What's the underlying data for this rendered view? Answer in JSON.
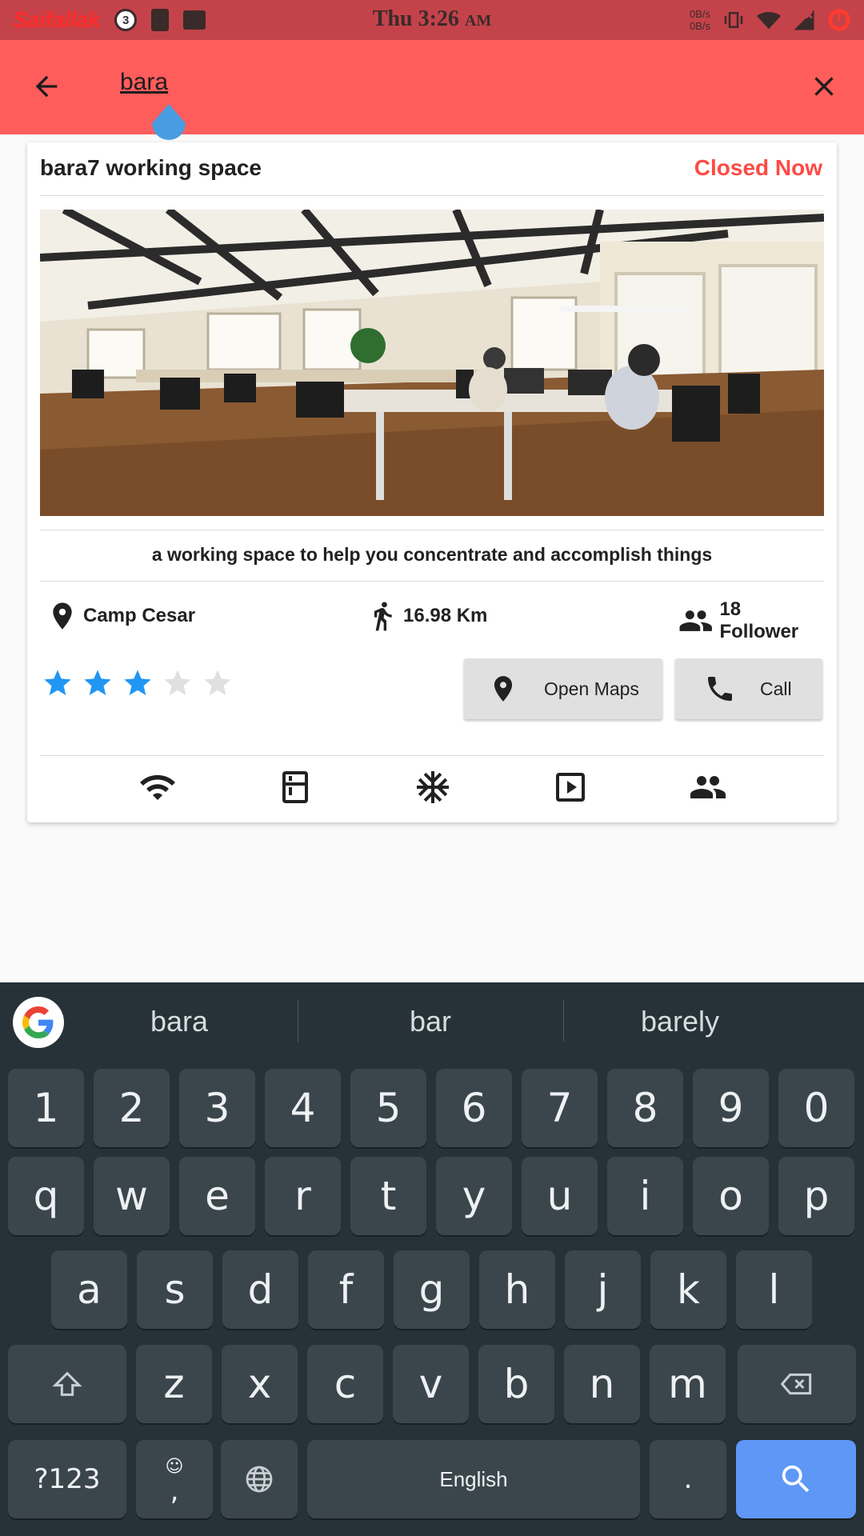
{
  "status_bar": {
    "brand": "Saifallak",
    "notif_count": "3",
    "time": "Thu 3:26",
    "time_suffix": "AM",
    "speed_up": "0B/s",
    "speed_down": "0B/s"
  },
  "app_bar": {
    "search_value": "bara"
  },
  "card": {
    "title": "bara7 working space",
    "status": "Closed Now",
    "description": "a working space to help you concentrate and accomplish things",
    "location": "Camp Cesar",
    "distance": "16.98 Km",
    "followers": "18 Follower",
    "rating": 3,
    "rating_max": 5,
    "open_maps_label": "Open Maps",
    "call_label": "Call",
    "amenities": [
      "wifi-icon",
      "fridge-icon",
      "ac-snowflake-icon",
      "projector-icon",
      "meeting-room-icon"
    ]
  },
  "colors": {
    "status_bar": "#c4434a",
    "app_bar": "#ff5c5c",
    "closed_status": "#ff4a44",
    "star_active": "#2196f3",
    "star_inactive": "#e0e0e0",
    "keyboard_bg": "#263238",
    "key_bg": "#3b464c",
    "search_key": "#5e97f6"
  },
  "keyboard": {
    "suggestions": [
      "bara",
      "bar",
      "barely"
    ],
    "row_numbers": [
      "1",
      "2",
      "3",
      "4",
      "5",
      "6",
      "7",
      "8",
      "9",
      "0"
    ],
    "row_1": [
      "q",
      "w",
      "e",
      "r",
      "t",
      "y",
      "u",
      "i",
      "o",
      "p"
    ],
    "row_2": [
      "a",
      "s",
      "d",
      "f",
      "g",
      "h",
      "j",
      "k",
      "l"
    ],
    "row_3": [
      "z",
      "x",
      "c",
      "v",
      "b",
      "n",
      "m"
    ],
    "symbols_label": "?123",
    "comma_label": ",",
    "space_label": "English",
    "period_label": "."
  }
}
